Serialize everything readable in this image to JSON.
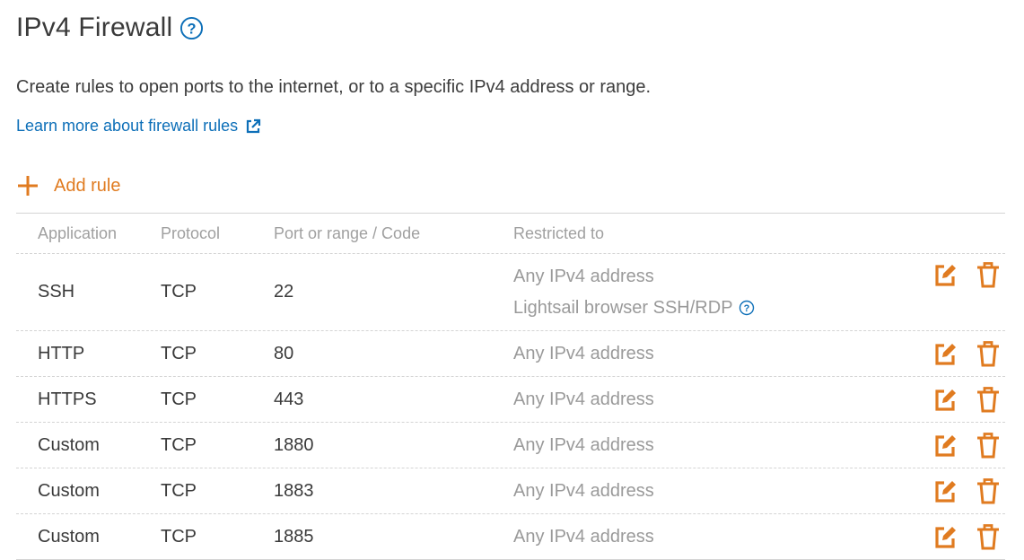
{
  "page": {
    "title": "IPv4 Firewall",
    "description": "Create rules to open ports to the internet, or to a specific IPv4 address or range.",
    "learn_more_label": "Learn more about firewall rules",
    "add_rule_label": "Add rule"
  },
  "colors": {
    "accent": "#e07b20",
    "link": "#0d6fb8",
    "muted_text": "#9a9a9a"
  },
  "icons": {
    "help": "help-icon",
    "external": "external-link-icon",
    "add": "plus-icon",
    "edit": "edit-icon",
    "delete": "trash-icon"
  },
  "table": {
    "columns": [
      "Application",
      "Protocol",
      "Port or range / Code",
      "Restricted to"
    ],
    "rows": [
      {
        "application": "SSH",
        "protocol": "TCP",
        "port": "22",
        "restricted": "Any IPv4 address",
        "restricted_extra": "Lightsail browser SSH/RDP"
      },
      {
        "application": "HTTP",
        "protocol": "TCP",
        "port": "80",
        "restricted": "Any IPv4 address"
      },
      {
        "application": "HTTPS",
        "protocol": "TCP",
        "port": "443",
        "restricted": "Any IPv4 address"
      },
      {
        "application": "Custom",
        "protocol": "TCP",
        "port": "1880",
        "restricted": "Any IPv4 address"
      },
      {
        "application": "Custom",
        "protocol": "TCP",
        "port": "1883",
        "restricted": "Any IPv4 address"
      },
      {
        "application": "Custom",
        "protocol": "TCP",
        "port": "1885",
        "restricted": "Any IPv4 address"
      }
    ]
  }
}
